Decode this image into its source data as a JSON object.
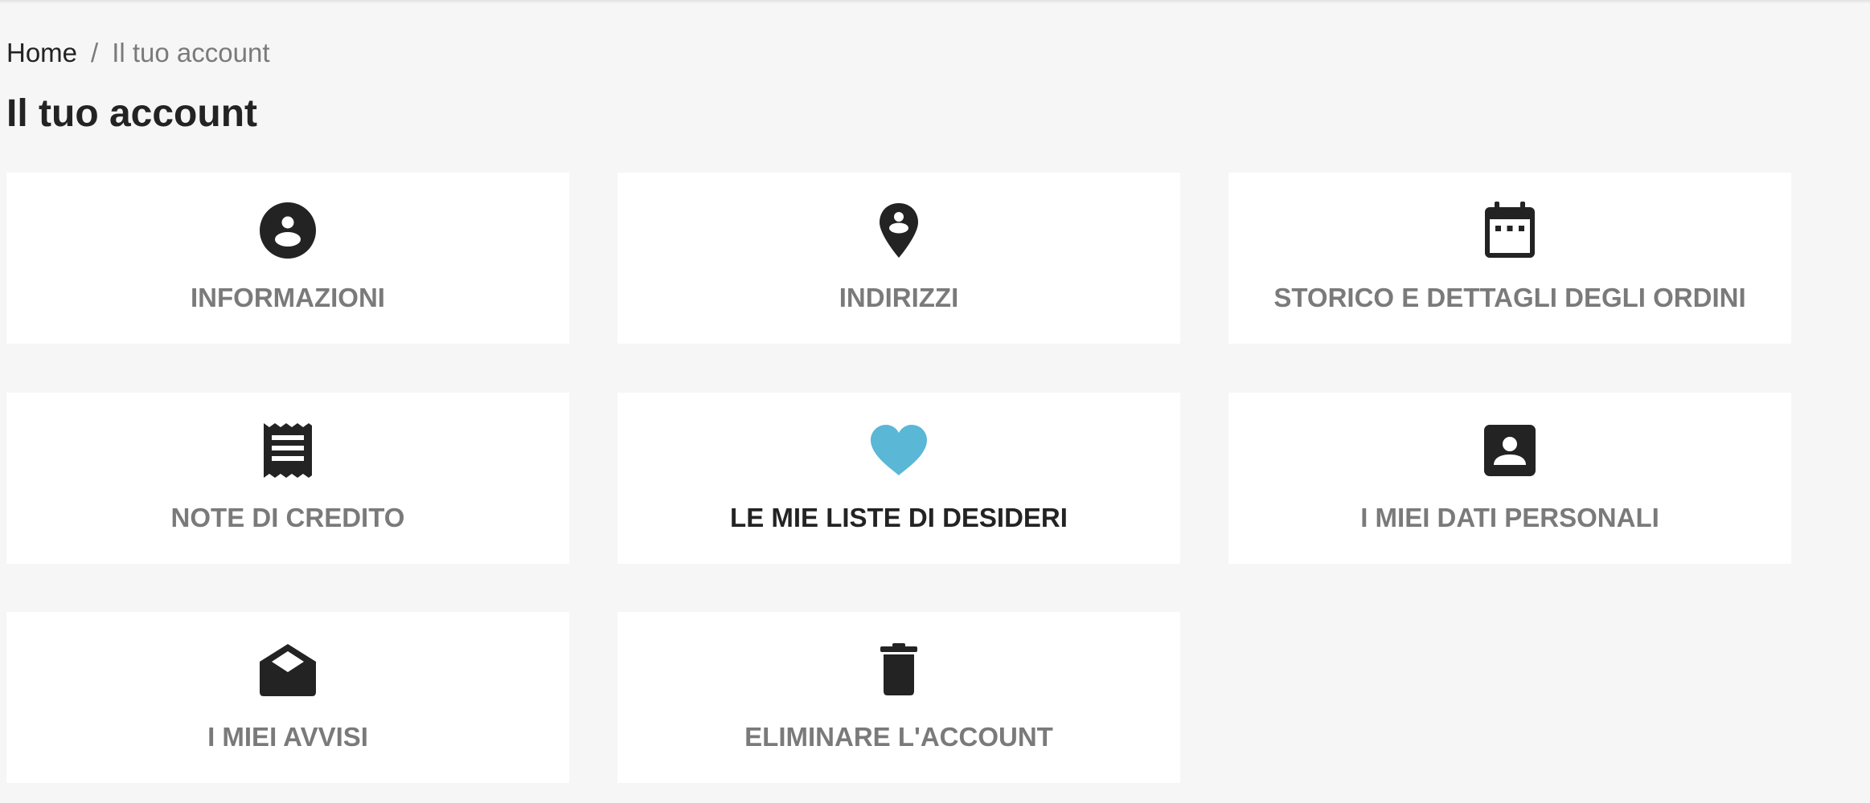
{
  "breadcrumb": {
    "home": "Home",
    "separator": "/",
    "current": "Il tuo account"
  },
  "page": {
    "title": "Il tuo account"
  },
  "account_links": [
    {
      "label": "INFORMAZIONI",
      "icon": "account-circle-icon"
    },
    {
      "label": "INDIRIZZI",
      "icon": "location-pin-icon"
    },
    {
      "label": "STORICO E DETTAGLI DEGLI ORDINI",
      "icon": "calendar-icon"
    },
    {
      "label": "NOTE DI CREDITO",
      "icon": "receipt-icon"
    },
    {
      "label": "LE MIE LISTE DI DESIDERI",
      "icon": "heart-icon",
      "state": "hover"
    },
    {
      "label": "I MIEI DATI PERSONALI",
      "icon": "contact-badge-icon"
    },
    {
      "label": "I MIEI AVVISI",
      "icon": "open-envelope-icon"
    },
    {
      "label": "ELIMINARE L'ACCOUNT",
      "icon": "trash-icon"
    }
  ],
  "colors": {
    "background": "#f6f6f6",
    "card": "#ffffff",
    "text": "#232323",
    "label_muted": "#7a7a7a",
    "accent_heart": "#5ab7d6"
  }
}
